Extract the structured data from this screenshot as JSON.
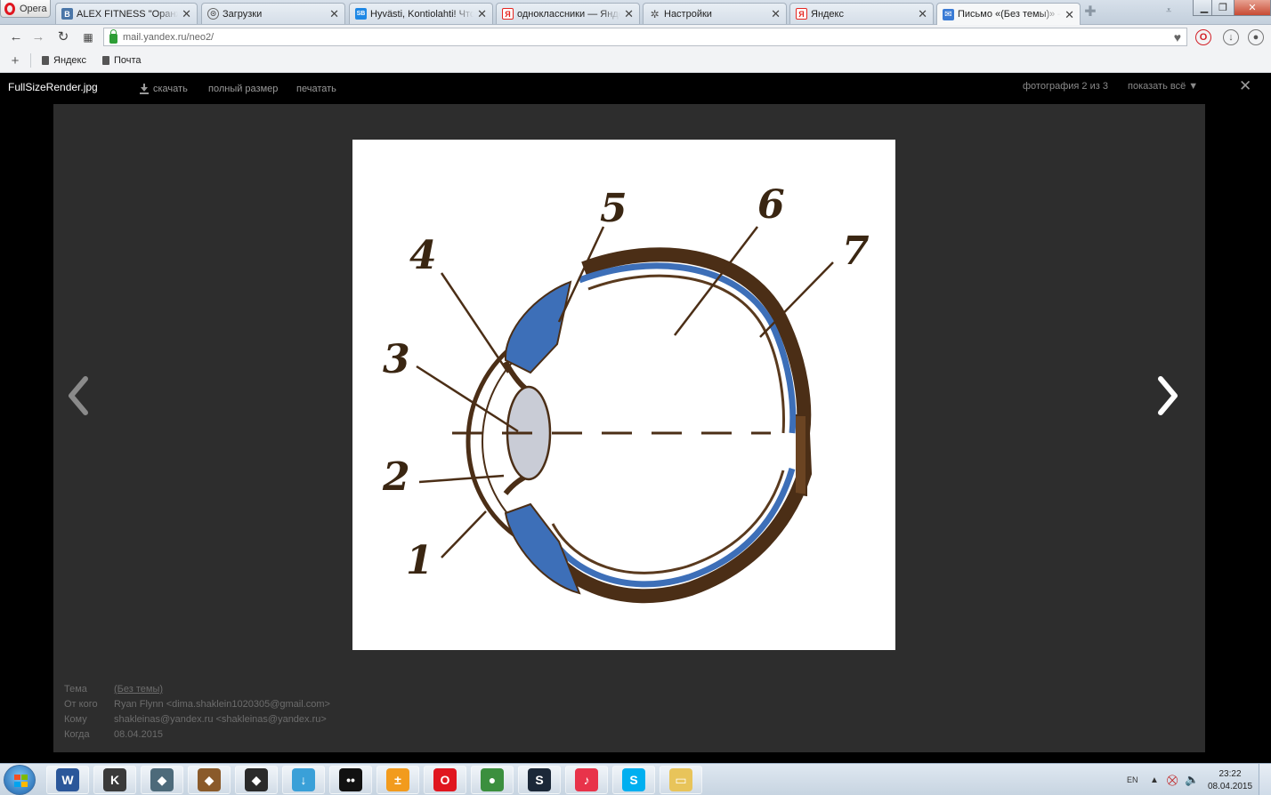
{
  "browser": {
    "menu_label": "Opera",
    "tabs": [
      {
        "title": "ALEX FITNESS \"Оранж Ме",
        "icon": "vk-icon",
        "icon_text": "В",
        "icon_color": "#4a76a8"
      },
      {
        "title": "Загрузки",
        "icon": "downloads-icon",
        "icon_text": "⊙",
        "icon_color": "#666666"
      },
      {
        "title": "Hyvästi, Kontiolahti! Что д",
        "icon": "sb-icon",
        "icon_text": "SB",
        "icon_color": "#1e88e5"
      },
      {
        "title": "одноклассники — Яндекс",
        "icon": "yandex-icon",
        "icon_text": "Я",
        "icon_color": "#e52620"
      },
      {
        "title": "Настройки",
        "icon": "settings-gear-icon",
        "icon_text": "✲",
        "icon_color": "#6b6b6b"
      },
      {
        "title": "Яндекс",
        "icon": "yandex-icon",
        "icon_text": "Я",
        "icon_color": "#e52620"
      },
      {
        "title": "Письмо «(Без темы)» — Я",
        "icon": "mail-icon",
        "icon_text": "✉",
        "icon_color": "#3a7bd5"
      }
    ],
    "url": "mail.yandex.ru/neo2/",
    "bookmarks": [
      {
        "label": "Яндекс"
      },
      {
        "label": "Почта"
      }
    ]
  },
  "viewer": {
    "filename": "FullSizeRender.jpg",
    "actions": {
      "download": "скачать",
      "full_size": "полный размер",
      "print": "печатать"
    },
    "counter": "фотография 2 из 3",
    "show_all": "показать всё ▼",
    "close_glyph": "✕"
  },
  "photo": {
    "labels": [
      "1",
      "2",
      "3",
      "4",
      "5",
      "6",
      "7"
    ]
  },
  "meta": {
    "subject_label": "Тема",
    "subject_value": "(Без темы)",
    "from_label": "От кого",
    "from_value": "Ryan Flynn <dima.shaklein1020305@gmail.com>",
    "to_label": "Кому",
    "to_value": "shakleinas@yandex.ru <shakleinas@yandex.ru>",
    "date_label": "Когда",
    "date_value": "08.04.2015"
  },
  "taskbar": {
    "apps": [
      {
        "name": "word",
        "icon_text": "W",
        "color": "#2b579a"
      },
      {
        "name": "counter-strike",
        "icon_text": "K",
        "color": "#3a3a3a"
      },
      {
        "name": "game-1",
        "icon_text": "◆",
        "color": "#4d6a7a"
      },
      {
        "name": "game-2",
        "icon_text": "◆",
        "color": "#8a5a2a"
      },
      {
        "name": "game-3",
        "icon_text": "◆",
        "color": "#2a2a2a"
      },
      {
        "name": "downloader",
        "icon_text": "↓",
        "color": "#3aa0d8"
      },
      {
        "name": "messenger",
        "icon_text": "••",
        "color": "#111111"
      },
      {
        "name": "calculator",
        "icon_text": "±",
        "color": "#f29b1d"
      },
      {
        "name": "opera",
        "icon_text": "O",
        "color": "#e0161f"
      },
      {
        "name": "chrome",
        "icon_text": "●",
        "color": "#3b8f3e"
      },
      {
        "name": "steam",
        "icon_text": "S",
        "color": "#1b2838"
      },
      {
        "name": "itunes",
        "icon_text": "♪",
        "color": "#e8334a"
      },
      {
        "name": "skype",
        "icon_text": "S",
        "color": "#00aff0"
      },
      {
        "name": "explorer",
        "icon_text": "▭",
        "color": "#e8c45a"
      }
    ],
    "lang": "EN",
    "time": "23:22",
    "date": "08.04.2015"
  }
}
